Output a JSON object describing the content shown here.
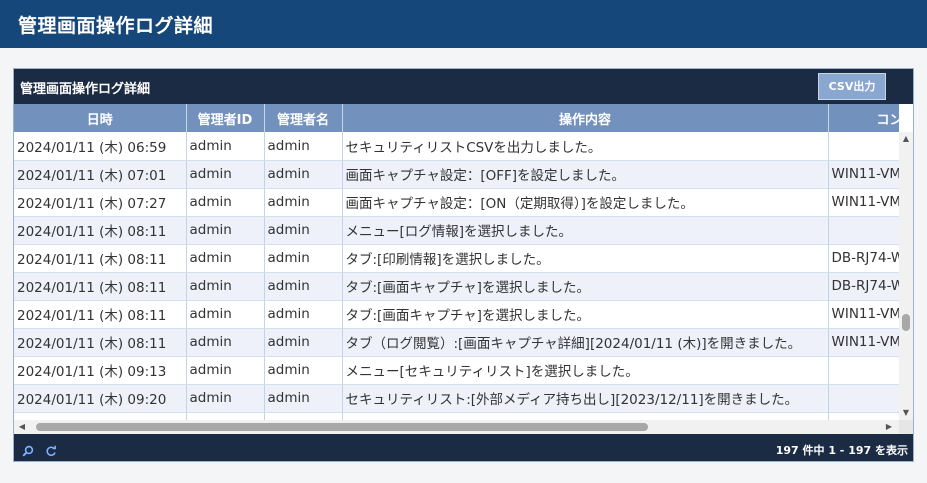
{
  "header": {
    "title": "管理画面操作ログ詳細"
  },
  "panel": {
    "title": "管理画面操作ログ詳細",
    "csv_button": "CSV出力"
  },
  "table": {
    "columns": [
      "日時",
      "管理者ID",
      "管理者名",
      "操作内容",
      "コンピュータ名"
    ],
    "rows": [
      [
        "2024/01/11 (木) 06:59",
        "admin",
        "admin",
        "セキュリティリストCSVを出力しました。",
        ""
      ],
      [
        "2024/01/11 (木) 07:01",
        "admin",
        "admin",
        "画面キャプチャ設定：[OFF]を設定しました。",
        "WIN11-VM"
      ],
      [
        "2024/01/11 (木) 07:27",
        "admin",
        "admin",
        "画面キャプチャ設定：[ON（定期取得）]を設定しました。",
        "WIN11-VM"
      ],
      [
        "2024/01/11 (木) 08:11",
        "admin",
        "admin",
        "メニュー[ログ情報]を選択しました。",
        ""
      ],
      [
        "2024/01/11 (木) 08:11",
        "admin",
        "admin",
        "タブ:[印刷情報]を選択しました。",
        "DB-RJ74-W"
      ],
      [
        "2024/01/11 (木) 08:11",
        "admin",
        "admin",
        "タブ:[画面キャプチャ]を選択しました。",
        "DB-RJ74-W"
      ],
      [
        "2024/01/11 (木) 08:11",
        "admin",
        "admin",
        "タブ:[画面キャプチャ]を選択しました。",
        "WIN11-VM"
      ],
      [
        "2024/01/11 (木) 08:11",
        "admin",
        "admin",
        "タブ（ログ閲覧）:[画面キャプチャ詳細][2024/01/11 (木)]を開きました。",
        "WIN11-VM"
      ],
      [
        "2024/01/11 (木) 09:13",
        "admin",
        "admin",
        "メニュー[セキュリティリスト]を選択しました。",
        ""
      ],
      [
        "2024/01/11 (木) 09:20",
        "admin",
        "admin",
        "セキュリティリスト:[外部メディア持ち出し][2023/12/11]を開きました。",
        ""
      ],
      [
        "",
        "",
        "",
        "",
        ""
      ]
    ]
  },
  "footer": {
    "search_icon": "search-icon",
    "refresh_icon": "refresh-icon",
    "record_info": "197 件中 1 - 197 を表示"
  },
  "colors": {
    "header_bg": "#16477a",
    "panel_bar_bg": "#1c2b44",
    "column_header_bg": "#7391bd",
    "row_alt_bg": "#eef0fa",
    "csv_button_bg": "#8aa7cf"
  }
}
